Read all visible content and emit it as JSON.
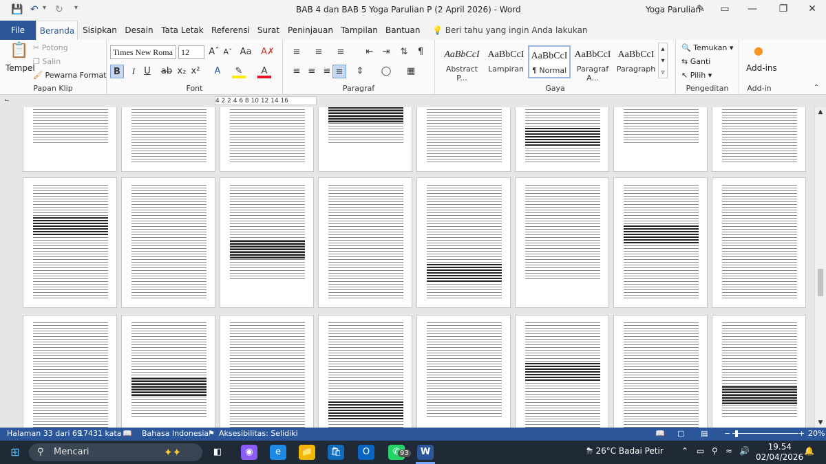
{
  "titlebar": {
    "title": "BAB 4 dan BAB 5 Yoga Parulian P (2 April 2026)  -  Word",
    "user": "Yoga Parulian"
  },
  "tabs": [
    {
      "label": "File"
    },
    {
      "label": "Beranda"
    },
    {
      "label": "Sisipkan"
    },
    {
      "label": "Desain"
    },
    {
      "label": "Tata Letak"
    },
    {
      "label": "Referensi"
    },
    {
      "label": "Surat"
    },
    {
      "label": "Peninjauan"
    },
    {
      "label": "Tampilan"
    },
    {
      "label": "Bantuan"
    }
  ],
  "tellme": "Beri tahu yang ingin Anda lakukan",
  "ribbon": {
    "clipboard": {
      "label": "Papan Klip",
      "paste": "Tempel",
      "cut": "Potong",
      "copy": "Salin",
      "format_painter": "Pewarna Format"
    },
    "font": {
      "label": "Font",
      "family": "Times New Roma",
      "size": "12"
    },
    "paragraph": {
      "label": "Paragraf"
    },
    "styles": {
      "label": "Gaya",
      "items": [
        {
          "preview": "AaBbCcI",
          "name": "Abstract P..."
        },
        {
          "preview": "AaBbCcI",
          "name": "Lampiran"
        },
        {
          "preview": "AaBbCcI",
          "name": "¶ Normal"
        },
        {
          "preview": "AaBbCcI",
          "name": "Paragraf A..."
        },
        {
          "preview": "AaBbCcI",
          "name": "Paragraph"
        }
      ]
    },
    "editing": {
      "label": "Pengeditan",
      "find": "Temukan",
      "replace": "Ganti",
      "select": "Pilih"
    },
    "addins": {
      "label": "Add-in",
      "button": "Add-ins"
    }
  },
  "ruler": "4  2     2  4  6  8  10  12  14  16",
  "status": {
    "page": "Halaman 33 dari 69",
    "words": "17431 kata",
    "language": "Bahasa Indonesia",
    "accessibility": "Aksesibilitas: Selidiki",
    "zoom": "20%"
  },
  "taskbar": {
    "search": "Mencari",
    "whatsapp_badge": "93",
    "weather": "26°C  Badai Petir",
    "time": "19.54",
    "date": "02/04/2026"
  }
}
